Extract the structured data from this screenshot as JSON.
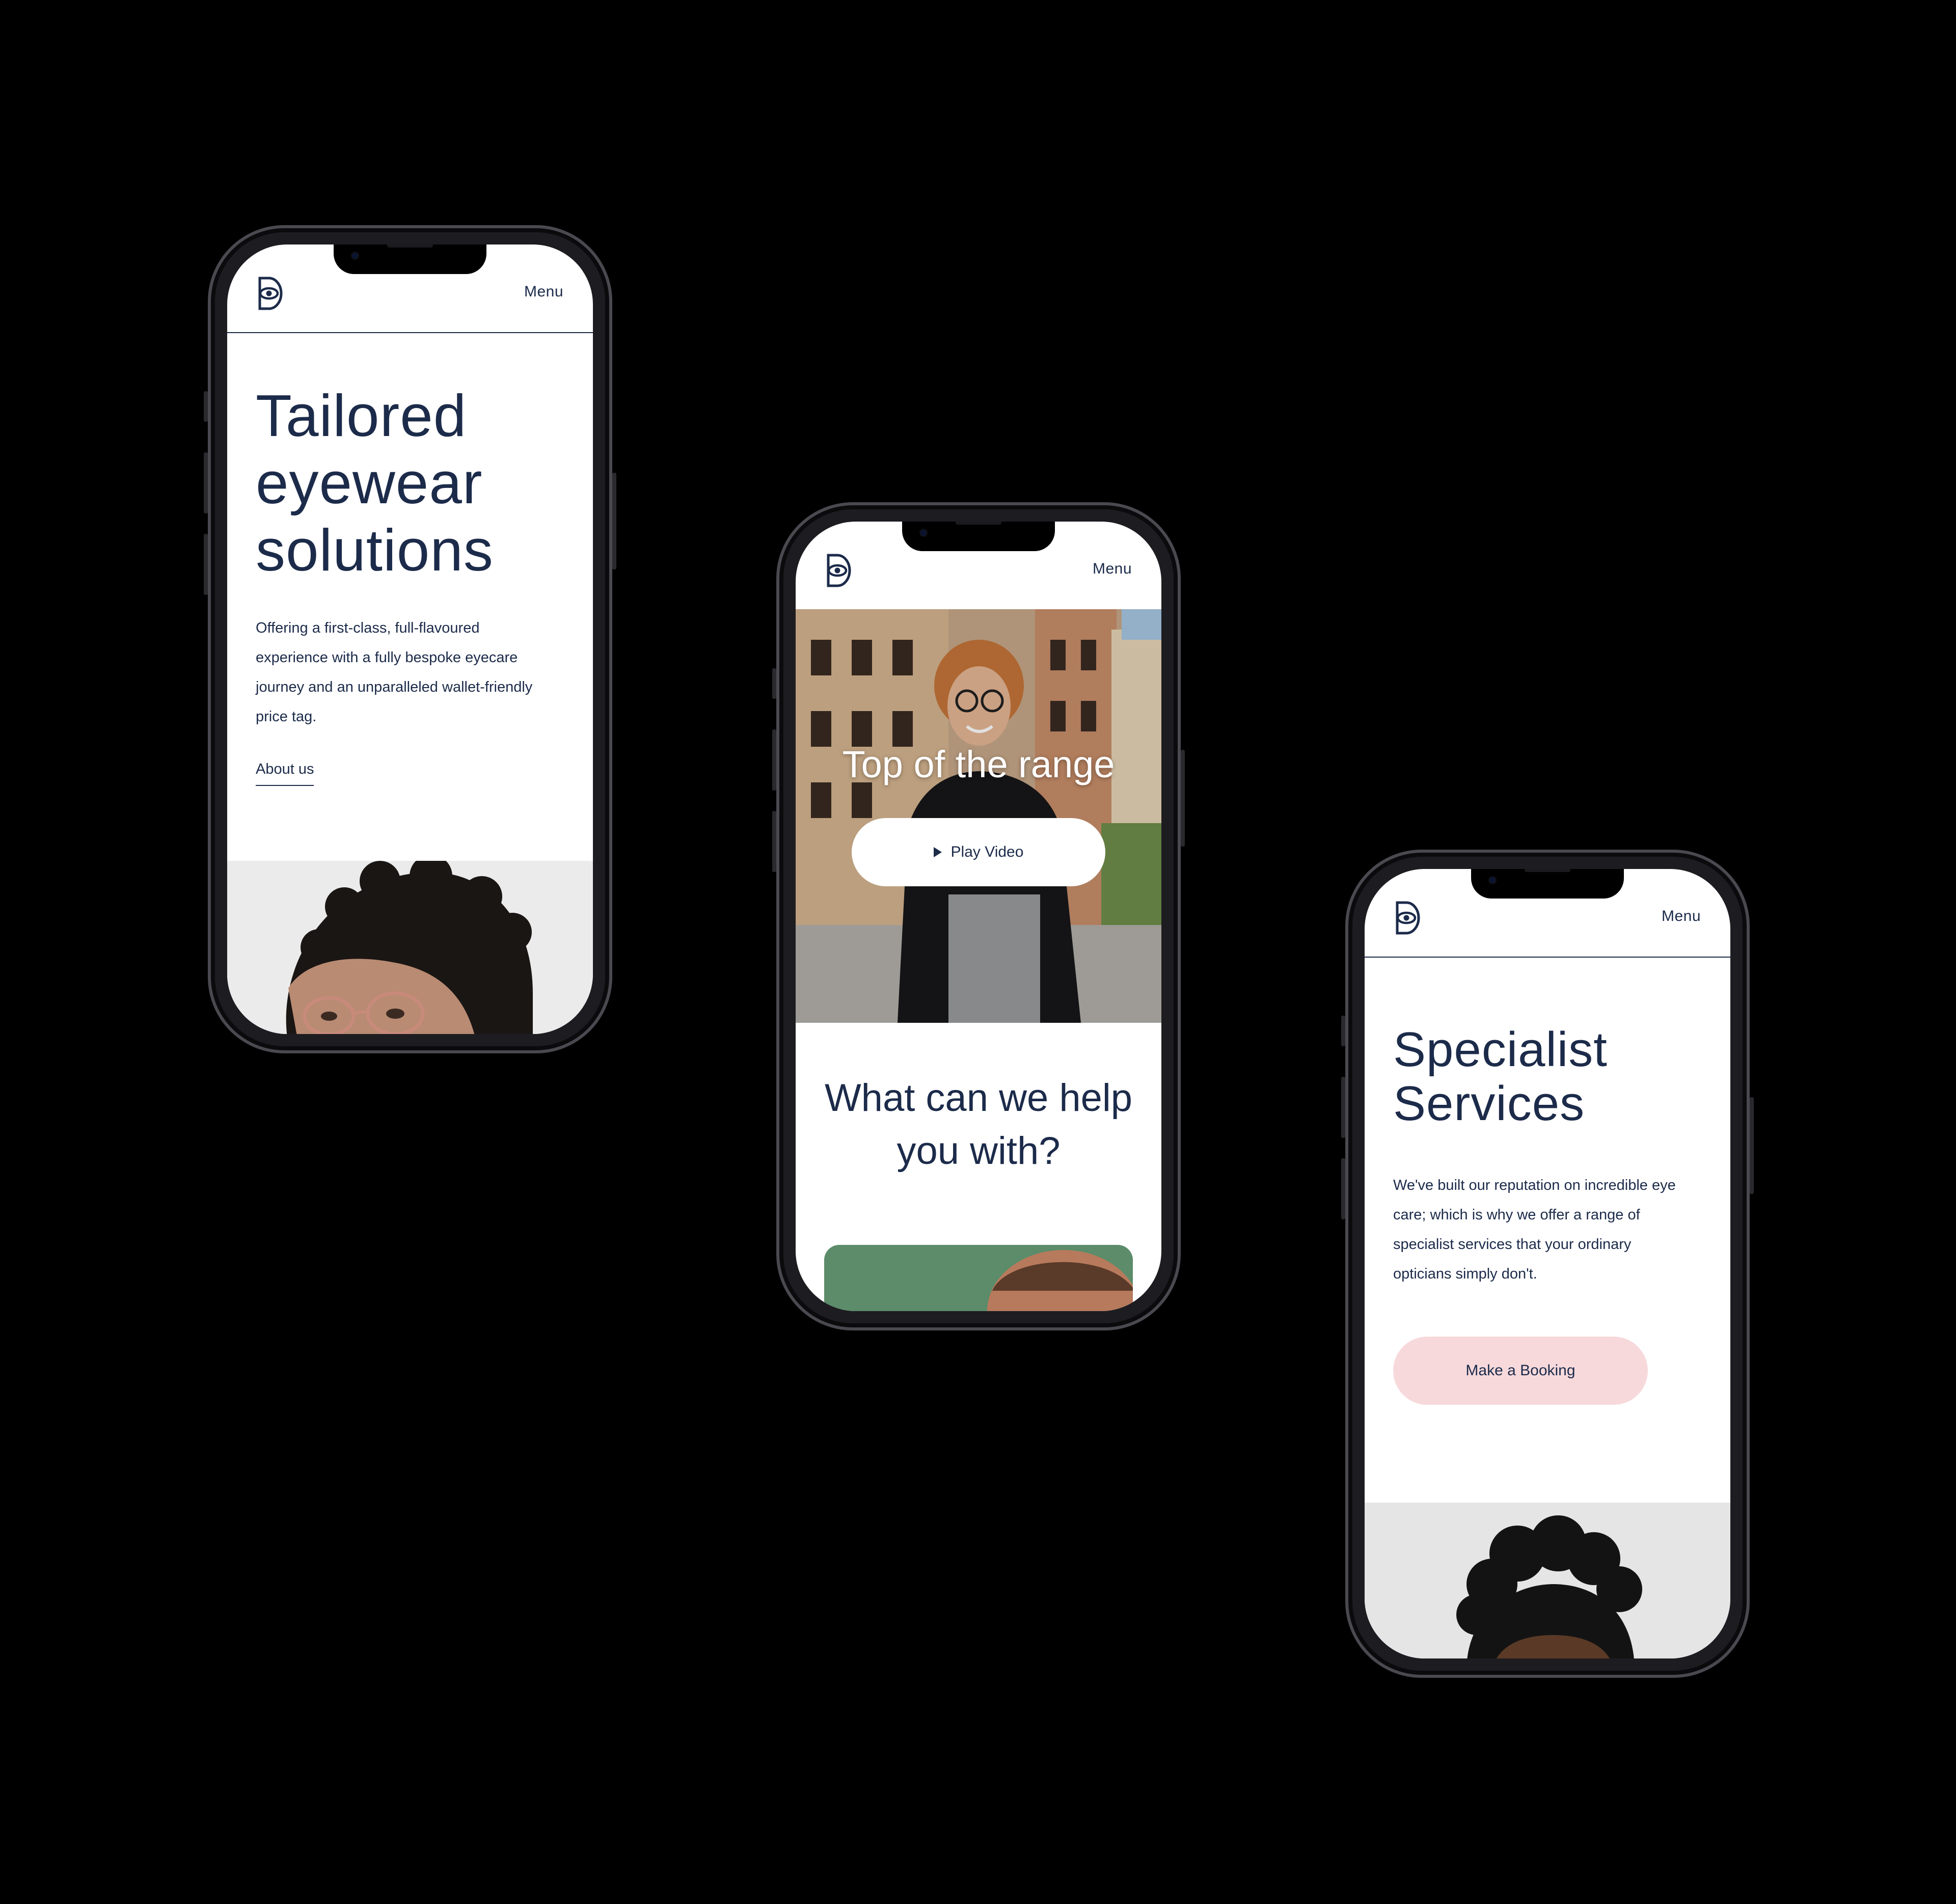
{
  "brand": {
    "logo_name": "eye-logo",
    "text_color": "#1c2b4a",
    "accent_pink": "#f7d9dc"
  },
  "phone1": {
    "menu_label": "Menu",
    "heading_lines": [
      "Tailored",
      "eyewear",
      "solutions"
    ],
    "paragraph_lines": [
      "Offering a first-class, full-flavoured",
      "experience with a fully bespoke  eyecare",
      "journey and an unparalleled wallet-friendly",
      "price tag."
    ],
    "link_label": "About us"
  },
  "phone2": {
    "menu_label": "Menu",
    "video_title": "Top of the range",
    "play_label": "Play Video",
    "section_heading_lines": [
      "What can we help",
      "you with?"
    ]
  },
  "phone3": {
    "menu_label": "Menu",
    "heading_lines": [
      "Specialist",
      "Services"
    ],
    "paragraph_lines": [
      "We've built our reputation on incredible eye",
      "care; which is why we offer a range of",
      "specialist services that your ordinary",
      "opticians simply don't."
    ],
    "booking_label": "Make a Booking"
  }
}
